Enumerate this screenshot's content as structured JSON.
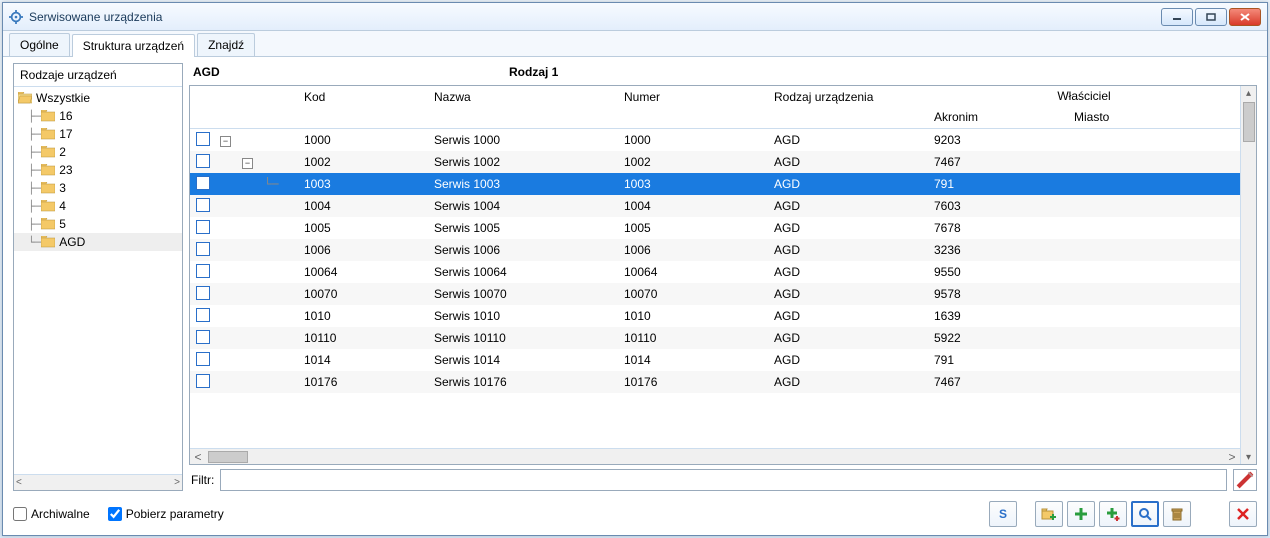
{
  "window": {
    "title": "Serwisowane urządzenia"
  },
  "tabs": {
    "general": "Ogólne",
    "structure": "Struktura urządzeń",
    "find": "Znajdź",
    "active": "structure"
  },
  "tree": {
    "header": "Rodzaje urządzeń",
    "root": "Wszystkie",
    "items": [
      "16",
      "17",
      "2",
      "23",
      "3",
      "4",
      "5",
      "AGD"
    ],
    "selected": "AGD"
  },
  "grid": {
    "title_left": "AGD",
    "title_right": "Rodzaj 1",
    "columns": {
      "kod": "Kod",
      "nazwa": "Nazwa",
      "numer": "Numer",
      "rodzaj": "Rodzaj urządzenia",
      "owner": "Właściciel",
      "akronim": "Akronim",
      "miasto": "Miasto"
    },
    "rows": [
      {
        "indent": 0,
        "exp": "-",
        "kod": "1000",
        "nazwa": "Serwis 1000",
        "numer": "1000",
        "rodzaj": "AGD",
        "akr": "9203",
        "miasto": "",
        "sel": false
      },
      {
        "indent": 1,
        "exp": "-",
        "kod": "1002",
        "nazwa": "Serwis 1002",
        "numer": "1002",
        "rodzaj": "AGD",
        "akr": "7467",
        "miasto": "",
        "sel": false
      },
      {
        "indent": 2,
        "exp": "",
        "kod": "1003",
        "nazwa": "Serwis 1003",
        "numer": "1003",
        "rodzaj": "AGD",
        "akr": "791",
        "miasto": "",
        "sel": true
      },
      {
        "indent": 0,
        "exp": "",
        "kod": "1004",
        "nazwa": "Serwis 1004",
        "numer": "1004",
        "rodzaj": "AGD",
        "akr": "7603",
        "miasto": "",
        "sel": false
      },
      {
        "indent": 0,
        "exp": "",
        "kod": "1005",
        "nazwa": "Serwis 1005",
        "numer": "1005",
        "rodzaj": "AGD",
        "akr": "7678",
        "miasto": "",
        "sel": false
      },
      {
        "indent": 0,
        "exp": "",
        "kod": "1006",
        "nazwa": "Serwis 1006",
        "numer": "1006",
        "rodzaj": "AGD",
        "akr": "3236",
        "miasto": "",
        "sel": false
      },
      {
        "indent": 0,
        "exp": "",
        "kod": "10064",
        "nazwa": "Serwis 10064",
        "numer": "10064",
        "rodzaj": "AGD",
        "akr": "9550",
        "miasto": "",
        "sel": false
      },
      {
        "indent": 0,
        "exp": "",
        "kod": "10070",
        "nazwa": "Serwis 10070",
        "numer": "10070",
        "rodzaj": "AGD",
        "akr": "9578",
        "miasto": "",
        "sel": false
      },
      {
        "indent": 0,
        "exp": "",
        "kod": "1010",
        "nazwa": "Serwis 1010",
        "numer": "1010",
        "rodzaj": "AGD",
        "akr": "1639",
        "miasto": "",
        "sel": false
      },
      {
        "indent": 0,
        "exp": "",
        "kod": "10110",
        "nazwa": "Serwis 10110",
        "numer": "10110",
        "rodzaj": "AGD",
        "akr": "5922",
        "miasto": "",
        "sel": false
      },
      {
        "indent": 0,
        "exp": "",
        "kod": "1014",
        "nazwa": "Serwis 1014",
        "numer": "1014",
        "rodzaj": "AGD",
        "akr": "791",
        "miasto": "",
        "sel": false
      },
      {
        "indent": 0,
        "exp": "",
        "kod": "10176",
        "nazwa": "Serwis 10176",
        "numer": "10176",
        "rodzaj": "AGD",
        "akr": "7467",
        "miasto": "",
        "sel": false
      }
    ]
  },
  "filter": {
    "label": "Filtr:",
    "value": ""
  },
  "footer": {
    "archival": "Archiwalne",
    "archival_checked": false,
    "fetch_params": "Pobierz parametry",
    "fetch_params_checked": true
  },
  "icons": {
    "s_button": "S"
  }
}
